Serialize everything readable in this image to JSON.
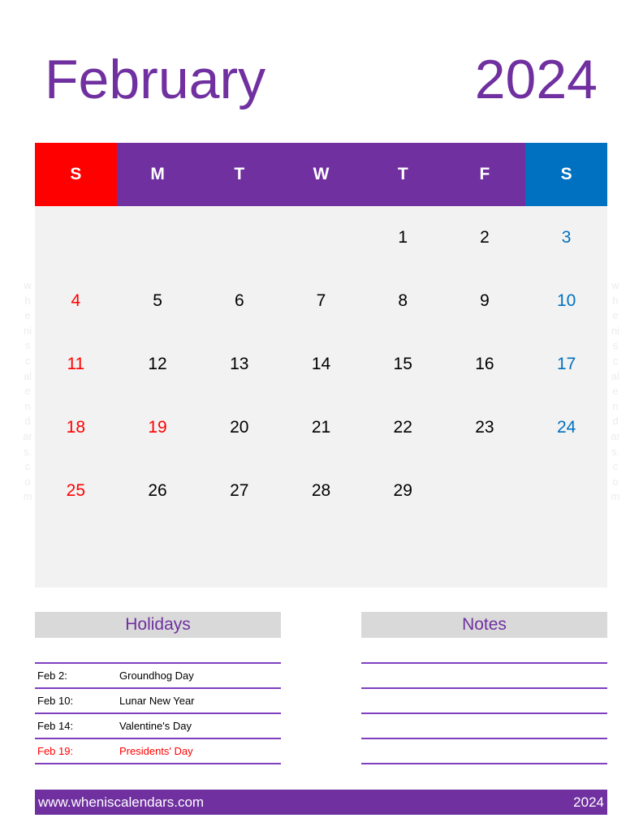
{
  "title": {
    "month": "February",
    "year": "2024"
  },
  "colors": {
    "accent": "#7030a0",
    "sunday": "#ff0000",
    "saturday": "#0070c0",
    "grid_bg": "#f2f2f2",
    "section_bg": "#d9d9d9"
  },
  "weekdays": [
    {
      "label": "S",
      "bg": "#ff0000"
    },
    {
      "label": "M",
      "bg": "#7030a0"
    },
    {
      "label": "T",
      "bg": "#7030a0"
    },
    {
      "label": "W",
      "bg": "#7030a0"
    },
    {
      "label": "T",
      "bg": "#7030a0"
    },
    {
      "label": "F",
      "bg": "#7030a0"
    },
    {
      "label": "S",
      "bg": "#0070c0"
    }
  ],
  "weeks": [
    [
      "",
      "",
      "",
      "",
      "1",
      "2",
      "3"
    ],
    [
      "4",
      "5",
      "6",
      "7",
      "8",
      "9",
      "10"
    ],
    [
      "11",
      "12",
      "13",
      "14",
      "15",
      "16",
      "17"
    ],
    [
      "18",
      "19",
      "20",
      "21",
      "22",
      "23",
      "24"
    ],
    [
      "25",
      "26",
      "27",
      "28",
      "29",
      "",
      ""
    ],
    [
      "",
      "",
      "",
      "",
      "",
      "",
      ""
    ]
  ],
  "holiday_days": [
    "19"
  ],
  "watermark": [
    "w",
    "h",
    "e",
    "ni",
    "s",
    "c",
    "al",
    "e",
    "n",
    "d",
    "ar",
    "s.",
    "c",
    "o",
    "m"
  ],
  "holidays": {
    "header": "Holidays",
    "items": [
      {
        "date": "Feb 2:",
        "name": "Groundhog Day",
        "highlight": false
      },
      {
        "date": "Feb 10:",
        "name": "Lunar New Year",
        "highlight": false
      },
      {
        "date": "Feb 14:",
        "name": "Valentine's Day",
        "highlight": false
      },
      {
        "date": "Feb 19:",
        "name": "Presidents' Day",
        "highlight": true
      }
    ]
  },
  "notes": {
    "header": "Notes"
  },
  "footer": {
    "url": "www.wheniscalendars.com",
    "year": "2024"
  }
}
